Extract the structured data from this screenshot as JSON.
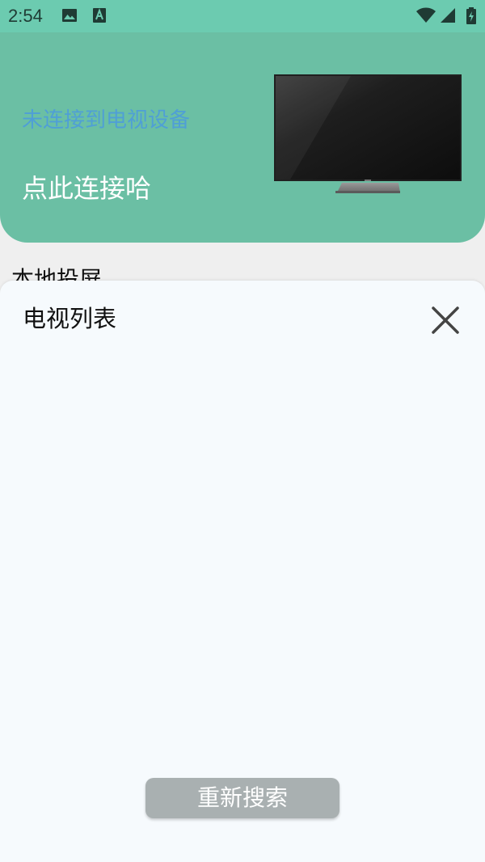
{
  "status_bar": {
    "time": "2:54",
    "icons": [
      "image-notification-icon",
      "a-notification-icon",
      "wifi-icon",
      "cell-signal-icon",
      "battery-charging-icon"
    ]
  },
  "header": {
    "connection_status": "未连接到电视设备",
    "connect_link": "点此连接哈",
    "colors": {
      "background": "#6bbfa4",
      "status_text": "#4f9fd6"
    }
  },
  "main": {
    "section_title": "本地投屏"
  },
  "sheet": {
    "title": "电视列表",
    "close_icon": "close-icon",
    "devices": [],
    "rescan_label": "重新搜索"
  }
}
